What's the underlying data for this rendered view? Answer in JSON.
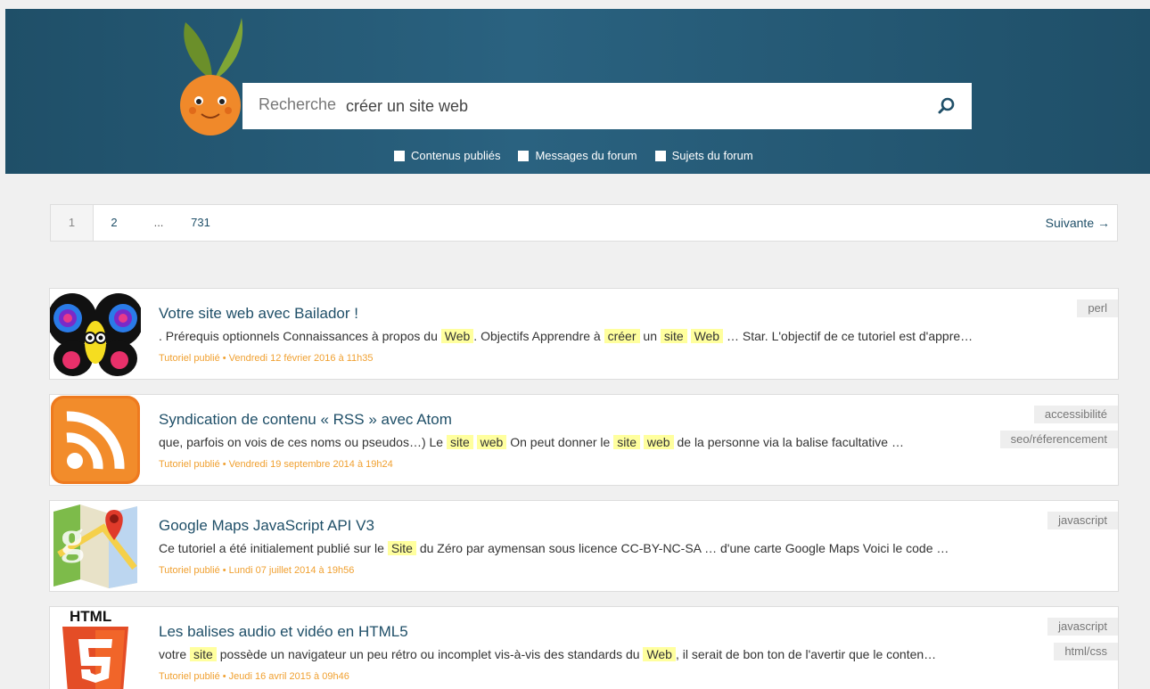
{
  "search": {
    "label": "Recherche",
    "value": "créer un site web"
  },
  "filters": [
    {
      "label": "Contenus publiés"
    },
    {
      "label": "Messages du forum"
    },
    {
      "label": "Sujets du forum"
    }
  ],
  "pagination": {
    "current": "1",
    "page2": "2",
    "dots": "...",
    "last": "731",
    "next": "Suivante →"
  },
  "results": [
    {
      "title": "Votre site web avec Bailador !",
      "excerpt": [
        ". Prérequis optionnels Connaissances à propos du ",
        "Web",
        ". Objectifs Apprendre à ",
        "créer",
        " un ",
        "site",
        " ",
        "Web",
        " … Star. L'objectif de ce tutoriel est d'appre…"
      ],
      "meta": "Tutoriel publié • Vendredi 12 février 2016 à 11h35",
      "tags": [
        "perl"
      ]
    },
    {
      "title": "Syndication de contenu « RSS » avec Atom",
      "excerpt": [
        "que, parfois on vois de ces noms ou pseudos…) Le ",
        "site",
        " ",
        "web",
        " On peut donner le ",
        "site",
        " ",
        "web",
        " de la personne via la balise facultative …"
      ],
      "meta": "Tutoriel publié • Vendredi 19 septembre 2014 à 19h24",
      "tags": [
        "accessibilité",
        "seo/réferencement"
      ]
    },
    {
      "title": "Google Maps JavaScript API V3",
      "excerpt": [
        "Ce tutoriel a été initialement publié sur le ",
        "Site",
        " du Zéro par aymensan sous licence CC-BY-NC-SA … d'une carte Google Maps Voici le code …"
      ],
      "meta": "Tutoriel publié • Lundi 07 juillet 2014 à 19h56",
      "tags": [
        "javascript"
      ]
    },
    {
      "title": "Les balises audio et vidéo en HTML5",
      "excerpt": [
        "votre ",
        "site",
        " possède un navigateur un peu rétro ou incomplet vis-à-vis des standards du ",
        "Web",
        ", il serait de bon ton de l'avertir que le conten…"
      ],
      "meta": "Tutoriel publié • Jeudi 16 avril 2015 à 09h46",
      "tags": [
        "javascript",
        "html/css"
      ],
      "logo_text": "HTML"
    }
  ]
}
